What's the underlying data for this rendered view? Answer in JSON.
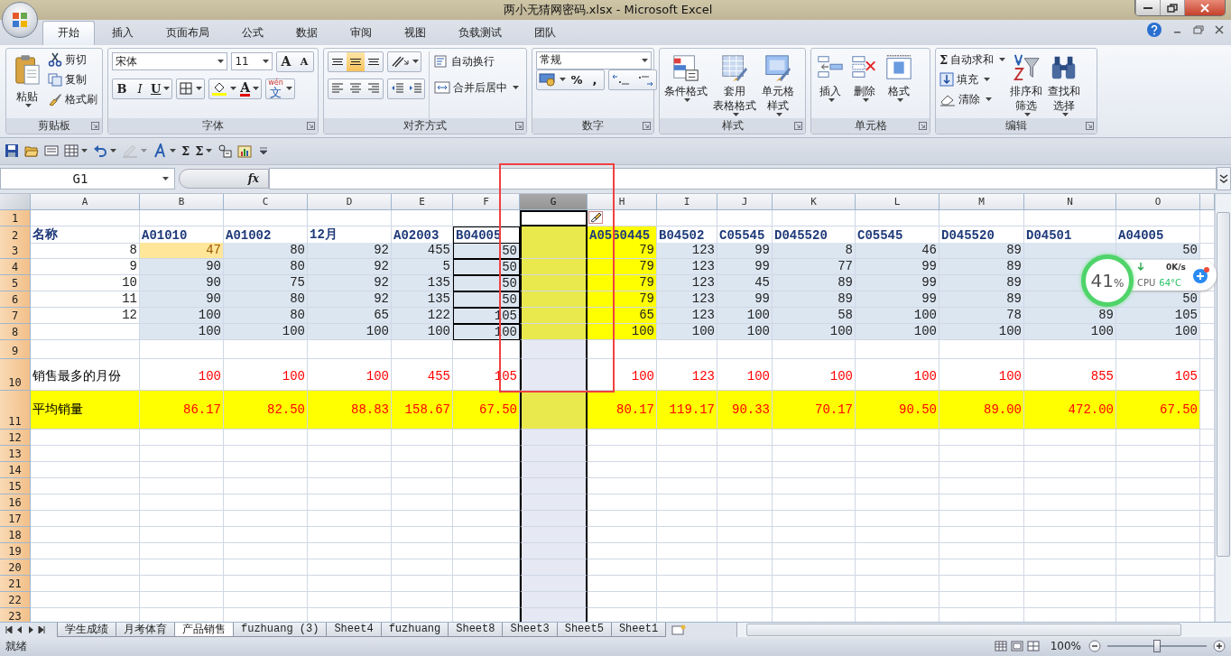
{
  "window": {
    "title": "两小无猜网密码.xlsx - Microsoft Excel"
  },
  "ribbon_tabs": [
    {
      "label": "开始",
      "selected": true
    },
    {
      "label": "插入",
      "selected": false
    },
    {
      "label": "页面布局",
      "selected": false
    },
    {
      "label": "公式",
      "selected": false
    },
    {
      "label": "数据",
      "selected": false
    },
    {
      "label": "审阅",
      "selected": false
    },
    {
      "label": "视图",
      "selected": false
    },
    {
      "label": "负载测试",
      "selected": false
    },
    {
      "label": "团队",
      "selected": false
    }
  ],
  "ribbon": {
    "clipboard": {
      "title": "剪贴板",
      "paste": "粘贴",
      "items": [
        {
          "kind": "cut",
          "label": "剪切"
        },
        {
          "kind": "copy",
          "label": "复制"
        },
        {
          "kind": "brush",
          "label": "格式刷"
        }
      ]
    },
    "font": {
      "title": "字体",
      "font_name": "宋体",
      "font_size": "11",
      "grow": "A",
      "shrink": "A",
      "bold": "B",
      "italic": "I",
      "underline": "U",
      "font_color": "A",
      "phonetic_top": "wén",
      "phonetic": "文"
    },
    "alignment": {
      "title": "对齐方式",
      "vertical_align": [
        {
          "selected": false
        },
        {
          "selected": true
        },
        {
          "selected": false
        }
      ],
      "wrap": "自动换行",
      "merge": "合并后居中"
    },
    "number": {
      "title": "数字",
      "format": "常规",
      "percent": "%",
      "comma": ","
    },
    "styles": {
      "title": "样式",
      "buttons": [
        {
          "kind": "conditional",
          "label_lines": [
            "条件格式"
          ]
        },
        {
          "kind": "table",
          "label_lines": [
            "套用",
            "表格格式"
          ]
        },
        {
          "kind": "cellstyle",
          "label_lines": [
            "单元格",
            "样式"
          ]
        }
      ]
    },
    "cells": {
      "title": "单元格",
      "buttons": [
        {
          "kind": "insert",
          "label_lines": [
            "插入"
          ]
        },
        {
          "kind": "delete",
          "label_lines": [
            "删除"
          ]
        },
        {
          "kind": "format",
          "label_lines": [
            "格式"
          ]
        }
      ]
    },
    "editing": {
      "title": "编辑",
      "items": [
        {
          "kind": "sum",
          "label": "自动求和",
          "symbol": "Σ"
        },
        {
          "kind": "fill",
          "label": "填充"
        },
        {
          "kind": "clear",
          "label": "清除"
        }
      ],
      "buttons": [
        {
          "kind": "sort",
          "label_lines": [
            "排序和",
            "筛选"
          ]
        },
        {
          "kind": "find",
          "label_lines": [
            "查找和",
            "选择"
          ]
        }
      ]
    }
  },
  "quick_access": [
    {
      "kind": "save",
      "disabled": false
    },
    {
      "kind": "open",
      "disabled": false
    },
    {
      "kind": "print",
      "disabled": false
    },
    {
      "kind": "table",
      "disabled": false
    },
    {
      "kind": "undo",
      "disabled": false
    },
    {
      "kind": "pen",
      "disabled": true
    },
    {
      "kind": "font",
      "disabled": false
    },
    {
      "kind": "sigma",
      "symbol": "Σ",
      "disabled": false
    },
    {
      "kind": "sigma",
      "symbol": "Σ",
      "disabled": false
    },
    {
      "kind": "replace",
      "disabled": false
    },
    {
      "kind": "chart",
      "disabled": false
    }
  ],
  "formula_bar": {
    "name_box": "G1",
    "fx": "fx"
  },
  "columns": [
    {
      "letter": "A",
      "selected": false,
      "highlight": false,
      "boxed": false
    },
    {
      "letter": "B",
      "selected": false,
      "highlight": false,
      "boxed": false
    },
    {
      "letter": "C",
      "selected": false,
      "highlight": false,
      "boxed": false
    },
    {
      "letter": "D",
      "selected": false,
      "highlight": false,
      "boxed": false
    },
    {
      "letter": "E",
      "selected": false,
      "highlight": false,
      "boxed": false
    },
    {
      "letter": "F",
      "selected": false,
      "highlight": false,
      "boxed": true
    },
    {
      "letter": "G",
      "selected": true,
      "highlight": true,
      "boxed": false
    },
    {
      "letter": "H",
      "selected": false,
      "highlight": true,
      "boxed": false
    },
    {
      "letter": "I",
      "selected": false,
      "highlight": false,
      "boxed": false
    },
    {
      "letter": "J",
      "selected": false,
      "highlight": false,
      "boxed": false
    },
    {
      "letter": "K",
      "selected": false,
      "highlight": false,
      "boxed": false
    },
    {
      "letter": "L",
      "selected": false,
      "highlight": false,
      "boxed": false
    },
    {
      "letter": "M",
      "selected": false,
      "highlight": false,
      "boxed": false
    },
    {
      "letter": "N",
      "selected": false,
      "highlight": false,
      "boxed": false
    },
    {
      "letter": "O",
      "selected": false,
      "highlight": false,
      "boxed": false
    }
  ],
  "rows": [
    {
      "number": "1",
      "kind": "blank"
    },
    {
      "number": "2",
      "kind": "header",
      "cells": [
        "名称",
        "A01010",
        "A01002",
        "12月",
        "A02003",
        "B04005",
        null,
        "A0560445",
        "B04502",
        "C05545",
        "D045520",
        "C05545",
        "D045520",
        "D04501",
        "A04005"
      ]
    },
    {
      "number": "3",
      "kind": "data",
      "cells": [
        "8",
        {
          "text": "47",
          "marked": true
        },
        "80",
        "92",
        "455",
        "50",
        null,
        "79",
        "123",
        "99",
        "8",
        "46",
        "89",
        null,
        "50"
      ]
    },
    {
      "number": "4",
      "kind": "data",
      "cells": [
        "9",
        "90",
        "80",
        "92",
        "5",
        "50",
        null,
        "79",
        "123",
        "99",
        "77",
        "99",
        "89",
        null,
        null
      ]
    },
    {
      "number": "5",
      "kind": "data",
      "cells": [
        "10",
        "90",
        "75",
        "92",
        "135",
        "50",
        null,
        "79",
        "123",
        "45",
        "89",
        "99",
        "89",
        null,
        null
      ]
    },
    {
      "number": "6",
      "kind": "data",
      "cells": [
        "11",
        "90",
        "80",
        "92",
        "135",
        "50",
        null,
        "79",
        "123",
        "99",
        "89",
        "99",
        "89",
        null,
        "50"
      ]
    },
    {
      "number": "7",
      "kind": "data",
      "cells": [
        "12",
        "100",
        "80",
        "65",
        "122",
        "105",
        null,
        "65",
        "123",
        "100",
        "58",
        "100",
        "78",
        "89",
        "105"
      ]
    },
    {
      "number": "8",
      "kind": "data",
      "cells": [
        null,
        "100",
        "100",
        "100",
        "100",
        "100",
        null,
        "100",
        "100",
        "100",
        "100",
        "100",
        "100",
        "100",
        "100"
      ]
    },
    {
      "number": "9",
      "kind": "spacer"
    },
    {
      "number": "10",
      "kind": "max",
      "cells": [
        "销售最多的月份",
        "100",
        "100",
        "100",
        "455",
        "105",
        null,
        "100",
        "123",
        "100",
        "100",
        "100",
        "100",
        "855",
        "105"
      ]
    },
    {
      "number": "11",
      "kind": "avg",
      "cells": [
        "平均销量",
        "86.17",
        "82.50",
        "88.83",
        "158.67",
        "67.50",
        null,
        "80.17",
        "119.17",
        "90.33",
        "70.17",
        "90.50",
        "89.00",
        "472.00",
        "67.50"
      ]
    },
    {
      "number": "12",
      "kind": "blank"
    },
    {
      "number": "13",
      "kind": "blank"
    },
    {
      "number": "14",
      "kind": "blank"
    },
    {
      "number": "15",
      "kind": "blank"
    },
    {
      "number": "16",
      "kind": "blank"
    },
    {
      "number": "17",
      "kind": "blank"
    },
    {
      "number": "18",
      "kind": "blank"
    },
    {
      "number": "19",
      "kind": "blank"
    },
    {
      "number": "20",
      "kind": "blank"
    },
    {
      "number": "21",
      "kind": "blank"
    },
    {
      "number": "22",
      "kind": "blank"
    },
    {
      "number": "23",
      "kind": "blank"
    }
  ],
  "sheet_tabs": [
    {
      "label": "学生成绩",
      "selected": false
    },
    {
      "label": "月考体育",
      "selected": false
    },
    {
      "label": "产品销售",
      "selected": true
    },
    {
      "label": "fuzhuang (3)",
      "selected": false
    },
    {
      "label": "Sheet4",
      "selected": false
    },
    {
      "label": "fuzhuang",
      "selected": false
    },
    {
      "label": "Sheet8",
      "selected": false
    },
    {
      "label": "Sheet3",
      "selected": false
    },
    {
      "label": "Sheet5",
      "selected": false
    },
    {
      "label": "Sheet1",
      "selected": false
    }
  ],
  "status_bar": {
    "status": "就绪",
    "zoom": "100%",
    "zoom_slider": {
      "level": 0.5
    }
  },
  "monitor_widget": {
    "percent": "41",
    "unit": "%",
    "speed": "0K/s",
    "cpu_label": "CPU",
    "temperature": "64°C"
  }
}
